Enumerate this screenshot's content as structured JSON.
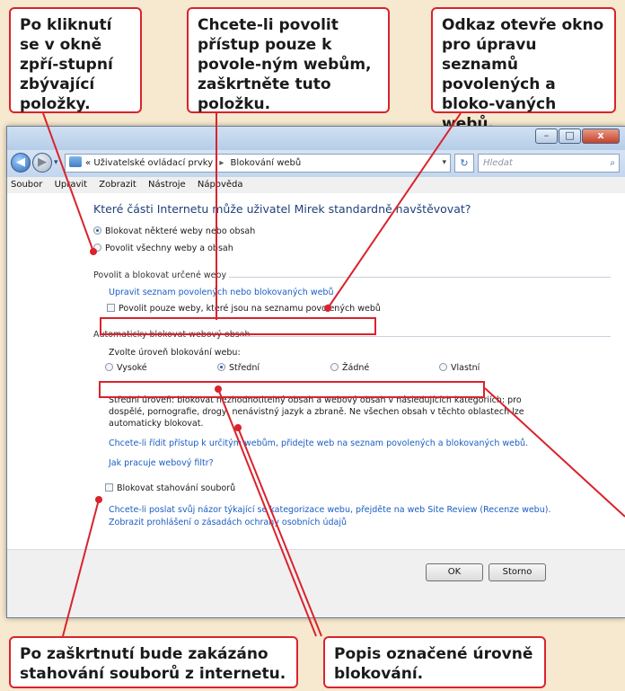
{
  "callouts": [
    {
      "text": "Po kliknutí se v okně zpří-stupní zbývající položky."
    },
    {
      "text": "Chcete-li povolit přístup pouze k povole-ným webům, zaškrtněte tuto položku."
    },
    {
      "text": "Odkaz otevře okno pro úpravu seznamů povolených a bloko-vaných webů."
    },
    {
      "text": "Po zaškrtnutí bude zakázáno stahování souborů z internetu."
    },
    {
      "text": "Popis označené úrovně blokování."
    }
  ],
  "window": {
    "buttons": {
      "minimize": "–",
      "maximize": "□",
      "close": "x"
    },
    "breadcrumb": {
      "overflow": "«",
      "part1": "Uživatelské ovládací prvky",
      "sep": "▸",
      "part2": "Blokování webů"
    },
    "search_placeholder": "Hledat",
    "menu": [
      "Soubor",
      "Upravit",
      "Zobrazit",
      "Nástroje",
      "Nápověda"
    ]
  },
  "content": {
    "heading": "Které části Internetu může uživatel Mirek standardně navštěvovat?",
    "radio_block": "Blokovat některé weby nebo obsah",
    "radio_allow": "Povolit všechny weby a obsah",
    "group1_title": "Povolit a blokovat určené weby",
    "edit_lists_link": "Upravit seznam povolených nebo blokovaných webů",
    "allowlist_only_check": "Povolit pouze weby, které jsou na seznamu povolených webů",
    "group2_title": "Automaticky blokovat webový obsah",
    "level_label": "Zvolte úroveň blokování webu:",
    "levels": [
      {
        "label": "Vysoké",
        "selected": false
      },
      {
        "label": "Střední",
        "selected": true
      },
      {
        "label": "Žádné",
        "selected": false
      },
      {
        "label": "Vlastní",
        "selected": false
      }
    ],
    "level_description": "Střední úroveň: blokovat nezhodnotitelný obsah a webový obsah v následujících kategoriích: pro dospělé, pornografie, drogy, nenávistný jazyk a zbraně. Ne všechen obsah v těchto oblastech lze automaticky blokovat.",
    "allow_specific_link": "Chcete-li řídit přístup k určitým webům, přidejte web na seznam povolených a blokovaných webů.",
    "how_filter_link": "Jak pracuje webový filtr?",
    "block_downloads_check": "Blokovat stahování souborů",
    "feedback_link": "Chcete-li poslat svůj názor týkající se kategorizace webu, přejděte na web Site Review (Recenze webu).",
    "privacy_link": "Zobrazit prohlášení o zásadách ochrany osobních údajů",
    "ok_button": "OK",
    "cancel_button": "Storno"
  },
  "colors": {
    "highlight": "#d9232d",
    "background": "#f7e9cf",
    "link": "#1a5dc4",
    "heading": "#1f3f7a"
  }
}
